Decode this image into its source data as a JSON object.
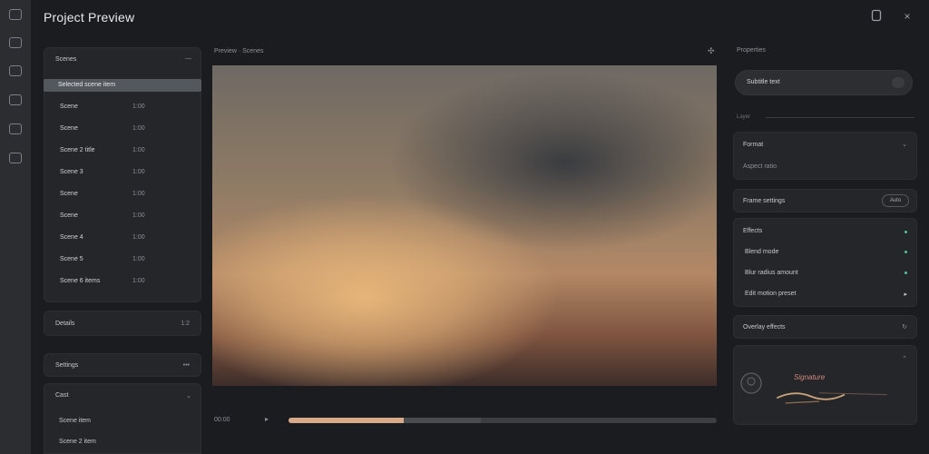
{
  "app": {
    "title": "Project Preview"
  },
  "window": {
    "minimize_icon": "minimize-icon",
    "close_icon": "close-icon",
    "close_label": "×"
  },
  "rail": {
    "icons": [
      "layers-icon",
      "image-icon",
      "list-icon",
      "settings-icon",
      "export-icon",
      "link-icon"
    ]
  },
  "left_panel": {
    "header": "Scenes",
    "selected": "Selected scene item",
    "items": [
      {
        "label": "Scene",
        "value": "1:00"
      },
      {
        "label": "Scene",
        "value": "1:00"
      },
      {
        "label": "Scene 2 title",
        "value": "1:00"
      },
      {
        "label": "Scene 3",
        "value": "1:00"
      },
      {
        "label": "Scene",
        "value": "1:00"
      },
      {
        "label": "Scene",
        "value": "1:00"
      },
      {
        "label": "Scene 4",
        "value": "1:00"
      },
      {
        "label": "Scene 5",
        "value": "1:00"
      },
      {
        "label": "Scene 6 items",
        "value": "1:00"
      }
    ],
    "section2": {
      "label": "Details",
      "value": "1:2"
    },
    "section3": {
      "label": "Settings",
      "value": "•••"
    },
    "section4": {
      "label": "Cast",
      "items": [
        "Scene item",
        "Scene 2 item"
      ]
    }
  },
  "preview": {
    "header": "Preview · Scenes",
    "pin_icon": "pin-icon",
    "time": "00:00",
    "play_label": "▸",
    "progress": 0.27,
    "buffered": 0.45
  },
  "right_panel": {
    "title": "Properties",
    "field_value": "Subtitle text",
    "divider_label": "Layer",
    "section_a": {
      "header": "Format",
      "value": "Aspect ratio"
    },
    "section_b": {
      "label": "Frame settings",
      "pill": "Auto"
    },
    "section_c": {
      "header": "Effects",
      "items": [
        "Blend mode",
        "Blur radius amount",
        "Edit motion preset"
      ]
    },
    "section_d": {
      "label": "Overlay effects",
      "icon": "refresh-icon"
    },
    "signature": {
      "text": "Signature"
    }
  },
  "colors": {
    "accent": "#d8aa8a",
    "status": "#4fc79a",
    "background": "#1b1c1f"
  }
}
